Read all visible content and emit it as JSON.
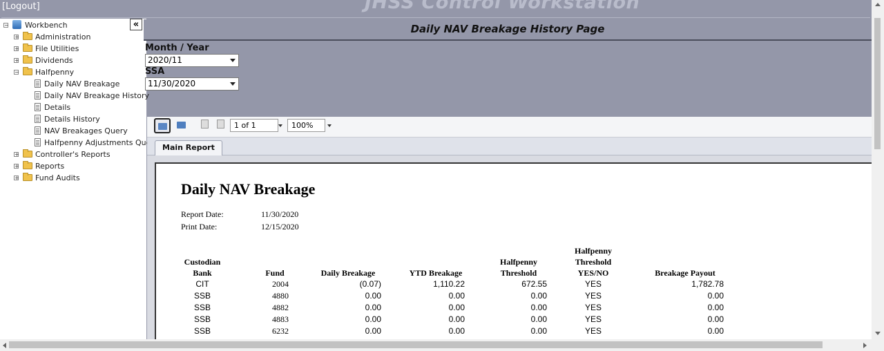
{
  "header": {
    "logout": "[Logout]",
    "app_title": "JHSS Control Workstation"
  },
  "sidebar": {
    "collapse_glyph": "«",
    "tree": [
      {
        "label": "Workbench",
        "type": "root",
        "expander": "−"
      },
      {
        "label": "Administration",
        "type": "folder",
        "expander": "+"
      },
      {
        "label": "File Utilities",
        "type": "folder",
        "expander": "+"
      },
      {
        "label": "Dividends",
        "type": "folder",
        "expander": "+"
      },
      {
        "label": "Halfpenny",
        "type": "folder",
        "expander": "−"
      },
      {
        "label": "Daily NAV Breakage",
        "type": "doc"
      },
      {
        "label": "Daily NAV Breakage History",
        "type": "doc"
      },
      {
        "label": "Details",
        "type": "doc"
      },
      {
        "label": "Details History",
        "type": "doc"
      },
      {
        "label": "NAV Breakages Query",
        "type": "doc"
      },
      {
        "label": "Halfpenny Adjustments Query",
        "type": "doc"
      },
      {
        "label": "Controller's Reports",
        "type": "folder",
        "expander": "+"
      },
      {
        "label": "Reports",
        "type": "folder",
        "expander": "+"
      },
      {
        "label": "Fund Audits",
        "type": "folder",
        "expander": "+"
      }
    ]
  },
  "main": {
    "page_title": "Daily NAV Breakage History Page",
    "month_year_label": "Month / Year",
    "month_year_value": "2020/11",
    "ssa_label": "SSA",
    "ssa_value": "11/30/2020"
  },
  "viewer": {
    "page_indicator": "1 of 1",
    "zoom": "100%",
    "tab_label": "Main Report",
    "report": {
      "title": "Daily NAV Breakage",
      "report_date_label": "Report Date:",
      "report_date": "11/30/2020",
      "print_date_label": "Print Date:",
      "print_date": "12/15/2020",
      "headers": {
        "custodian": [
          "Custodian",
          "Bank"
        ],
        "fund": "Fund",
        "daily": "Daily Breakage",
        "ytd": "YTD Breakage",
        "threshold": [
          "Halfpenny",
          "Threshold"
        ],
        "yesno": [
          "Halfpenny",
          "Threshold",
          "YES/NO"
        ],
        "payout": "Breakage Payout"
      },
      "rows": [
        {
          "bank": "CIT",
          "fund": "2004",
          "daily": "(0.07)",
          "ytd": "1,110.22",
          "threshold": "672.55",
          "yesno": "YES",
          "payout": "1,782.78"
        },
        {
          "bank": "SSB",
          "fund": "4880",
          "daily": "0.00",
          "ytd": "0.00",
          "threshold": "0.00",
          "yesno": "YES",
          "payout": "0.00"
        },
        {
          "bank": "SSB",
          "fund": "4882",
          "daily": "0.00",
          "ytd": "0.00",
          "threshold": "0.00",
          "yesno": "YES",
          "payout": "0.00"
        },
        {
          "bank": "SSB",
          "fund": "4883",
          "daily": "0.00",
          "ytd": "0.00",
          "threshold": "0.00",
          "yesno": "YES",
          "payout": "0.00"
        },
        {
          "bank": "SSB",
          "fund": "6232",
          "daily": "0.00",
          "ytd": "0.00",
          "threshold": "0.00",
          "yesno": "YES",
          "payout": "0.00"
        }
      ]
    }
  }
}
